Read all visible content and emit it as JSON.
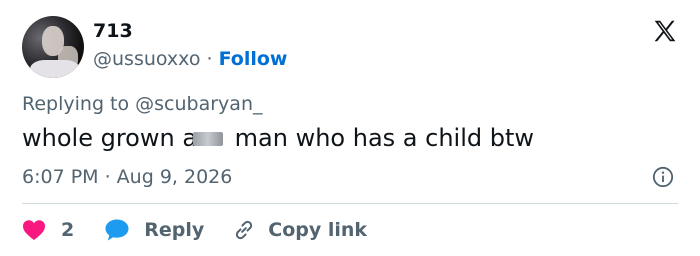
{
  "author": {
    "display_name": "713",
    "handle": "@ussuoxxo",
    "separator": "·",
    "follow_label": "Follow"
  },
  "tweet": {
    "replying_prefix": "Replying to ",
    "replying_to": "@scubaryan_",
    "text_before": "whole grown a",
    "text_after": " man who has a child btw",
    "timestamp": "6:07 PM · Aug 9, 2026"
  },
  "actions": {
    "like_count": "2",
    "reply_label": "Reply",
    "copy_label": "Copy link"
  },
  "colors": {
    "link_blue": "#006fd6",
    "like_red": "#f91880",
    "reply_blue": "#1d9bf0",
    "muted": "#536471"
  },
  "icons": [
    "x-logo-icon",
    "info-icon",
    "heart-icon",
    "speech-bubble-icon",
    "link-icon"
  ]
}
